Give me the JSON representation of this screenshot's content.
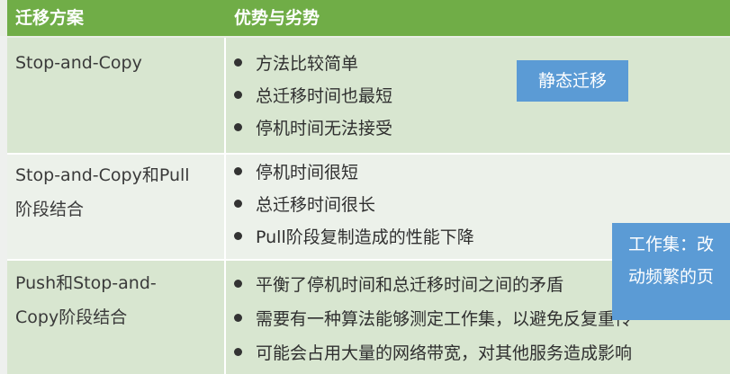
{
  "header": {
    "col1": "迁移方案",
    "col2": "优势与劣势"
  },
  "rows": [
    {
      "scheme_lines": [
        "Stop-and-Copy"
      ],
      "points": [
        "方法比较简单",
        "总迁移时间也最短",
        "停机时间无法接受"
      ]
    },
    {
      "scheme_lines": [
        "Stop-and-Copy和Pull",
        "阶段结合"
      ],
      "points": [
        "停机时间很短",
        "总迁移时间很长",
        "Pull阶段复制造成的性能下降"
      ]
    },
    {
      "scheme_lines": [
        "Push和Stop-and-",
        "Copy阶段结合"
      ],
      "points": [
        "平衡了停机时间和总迁移时间之间的矛盾",
        "需要有一种算法能够测定工作集，以避免反复重传",
        "可能会占用大量的网络带宽，对其他服务造成影响"
      ]
    }
  ],
  "tags": {
    "static": "静态迁移",
    "working_set_line1": "工作集：改",
    "working_set_line2": "动频繁的页"
  },
  "colors": {
    "header_bg": "#70ad47",
    "row_odd": "#d8e6d0",
    "row_even": "#ecf1ea",
    "tag_bg": "#5b9bd5"
  }
}
